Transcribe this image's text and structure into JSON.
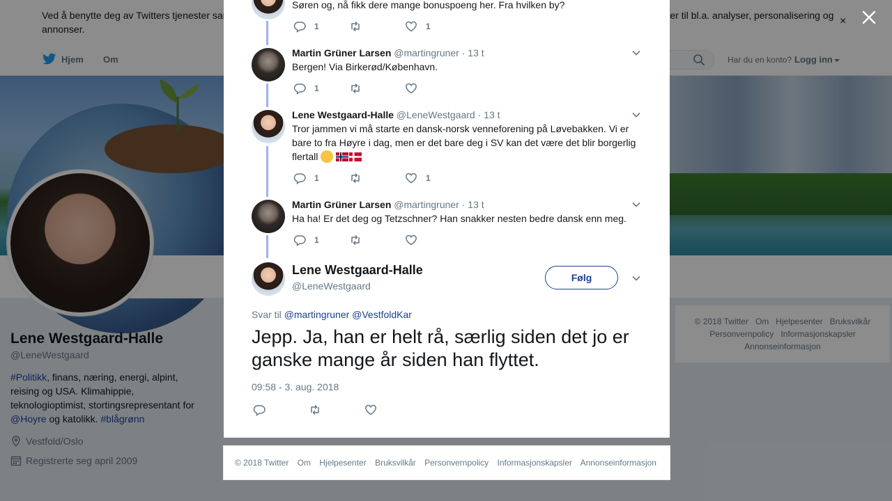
{
  "cookie": {
    "text": "Ved å benytte deg av Twitters tjenester samtykker du til vår bruk av informasjonskapsler. Vi og våre samarbeidspartnere bruker informasjonskapsler til bl.a. analyser, personalisering og annonser.",
    "close": "×"
  },
  "nav": {
    "home": "Hjem",
    "about": "Om",
    "account_question": "Har du en konto?",
    "login": "Logg inn"
  },
  "profile": {
    "name": "Lene Westgaard-Halle",
    "handle": "@LeneWestgaard",
    "bio": {
      "hashtag1": "#Politikk",
      "text1": ", finans, næring, energi, alpint, reising og USA. Klimahippie, teknologioptimist, stortingsrepresentant for ",
      "mention": "@Hoyre",
      "text2": " og katolikk. ",
      "hashtag2": "#blågrønn"
    },
    "location": "Vestfold/Oslo",
    "joined": "Registrerte seg april 2009"
  },
  "side_footer": [
    "© 2018 Twitter",
    "Om",
    "Hjelpesenter",
    "Bruksvilkår",
    "Personvernpolicy",
    "Informasjonskapsler",
    "Annonseinformasjon"
  ],
  "thread": [
    {
      "text": "Søren og, nå fikk dere mange bonuspoeng her. Fra hvilken by?",
      "replies": "1",
      "retweets": "",
      "likes": "1"
    },
    {
      "name": "Martin Grüner Larsen",
      "handle": "@martingruner",
      "time": "· 13 t",
      "text": "Bergen! Via Birkerød/København.",
      "replies": "1",
      "retweets": "",
      "likes": ""
    },
    {
      "name": "Lene Westgaard-Halle",
      "handle": "@LeneWestgaard",
      "time": "· 13 t",
      "text": "Tror jammen vi må starte en dansk-norsk venneforening på Løvebakken. Vi er bare to fra Høyre i dag, men er det bare deg i SV kan det være det blir borgerlig flertall",
      "replies": "1",
      "retweets": "",
      "likes": "1"
    },
    {
      "name": "Martin Grüner Larsen",
      "handle": "@martingruner",
      "time": "· 13 t",
      "text": "Ha ha! Er det deg og Tetzschner? Han snakker nesten bedre dansk enn meg.",
      "replies": "1",
      "retweets": "",
      "likes": ""
    }
  ],
  "main_tweet": {
    "name": "Lene Westgaard-Halle",
    "handle": "@LeneWestgaard",
    "follow": "Følg",
    "reply_prefix": "Svar til",
    "reply_to_1": "@martingruner",
    "reply_to_2": "@VestfoldKar",
    "text": "Jepp. Ja, han er helt rå, særlig siden det jo er ganske mange år siden han flyttet.",
    "time": "09:58 - 3. aug. 2018"
  },
  "modal_footer": [
    "© 2018 Twitter",
    "Om",
    "Hjelpesenter",
    "Bruksvilkår",
    "Personvernpolicy",
    "Informasjonskapsler",
    "Annonseinformasjon"
  ],
  "colors": {
    "link": "#1b3e98",
    "thread_line": "#a1b0f0",
    "secondary_text": "#657786"
  }
}
